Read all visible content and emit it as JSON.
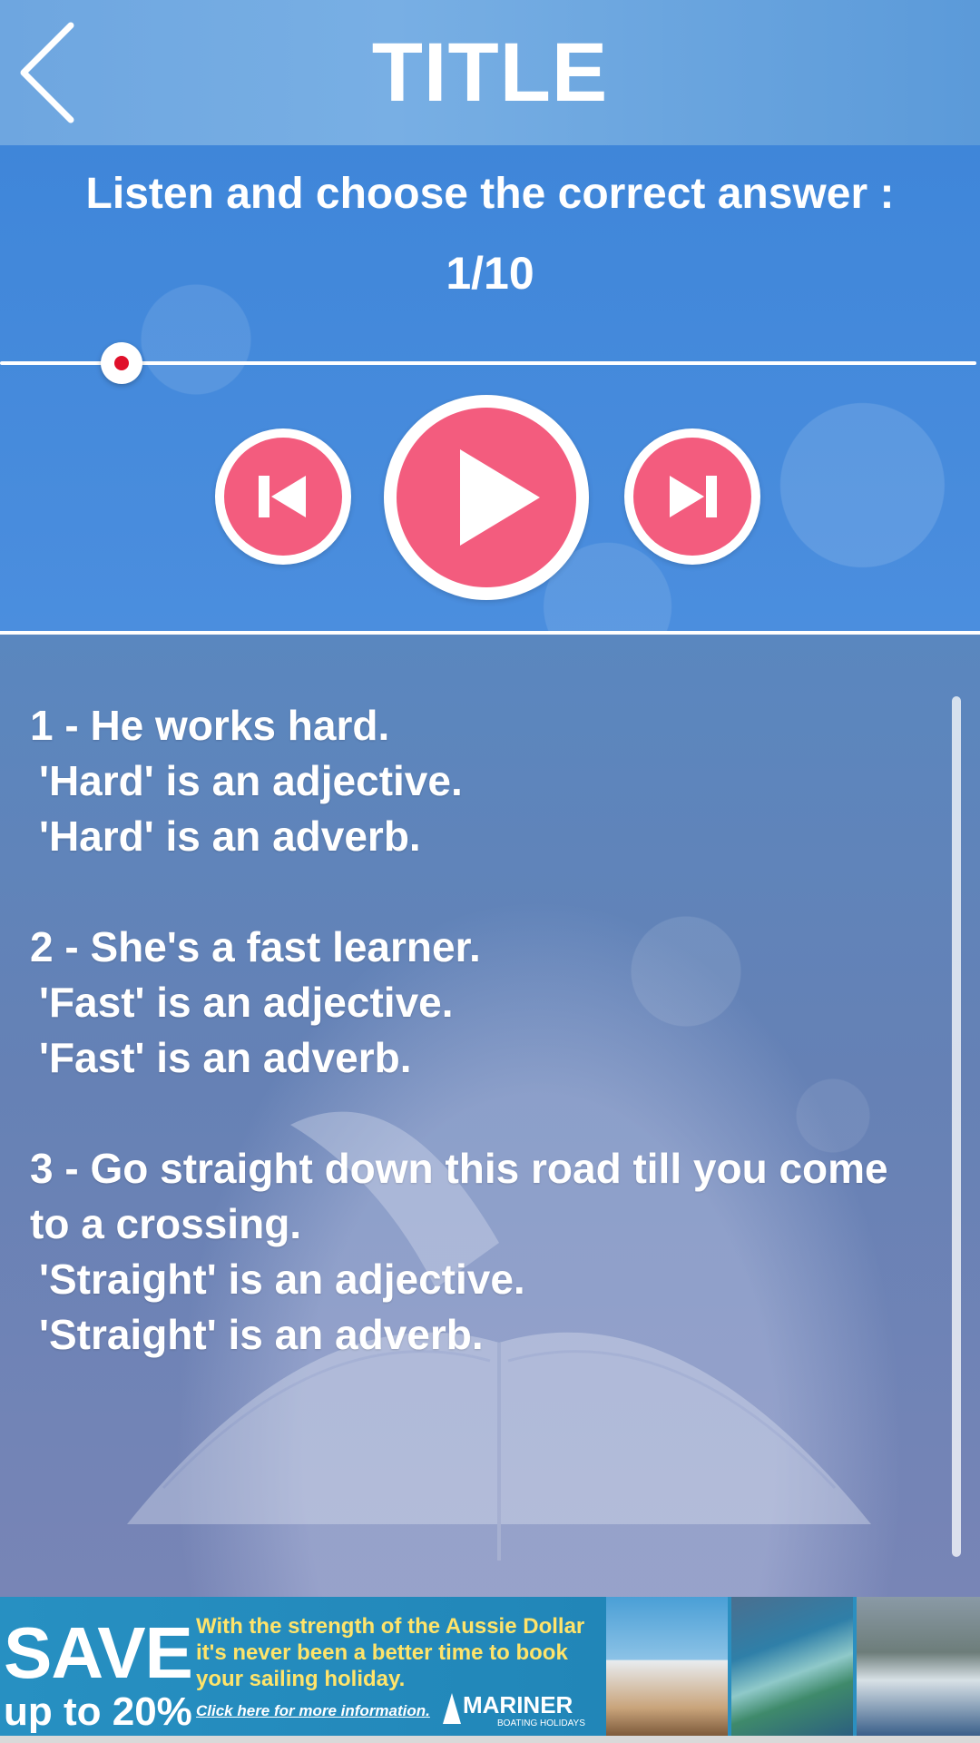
{
  "header": {
    "title": "TITLE",
    "back_icon": "chevron-left-icon"
  },
  "player": {
    "instruction": "Listen and choose the correct answer :",
    "counter": "1/10",
    "progress": 0.06,
    "controls": {
      "previous_icon": "skip-previous-icon",
      "play_icon": "play-icon",
      "next_icon": "skip-next-icon"
    },
    "colors": {
      "button_fill": "#f35c7e",
      "button_ring": "#ffffff",
      "thumb_dot": "#e0102a"
    }
  },
  "questions": [
    {
      "prompt": "1 - He works hard.",
      "options": [
        " 'Hard' is an adjective.",
        " 'Hard' is an adverb."
      ]
    },
    {
      "prompt": "2 - She's a fast learner.",
      "options": [
        " 'Fast' is an adjective.",
        " 'Fast' is an adverb."
      ]
    },
    {
      "prompt": "3 - Go straight down this road till you come to a crossing.",
      "options": [
        " 'Straight' is an adjective.",
        " 'Straight' is an adverb."
      ]
    }
  ],
  "ad": {
    "save": "SAVE",
    "up_to": "up to 20%",
    "message": "With the strength of the Aussie Dollar it's never been a better time to book your sailing holiday.",
    "link": "Click here for more information.",
    "brand": "MARINER",
    "brand_sub": "BOATING HOLIDAYS"
  }
}
